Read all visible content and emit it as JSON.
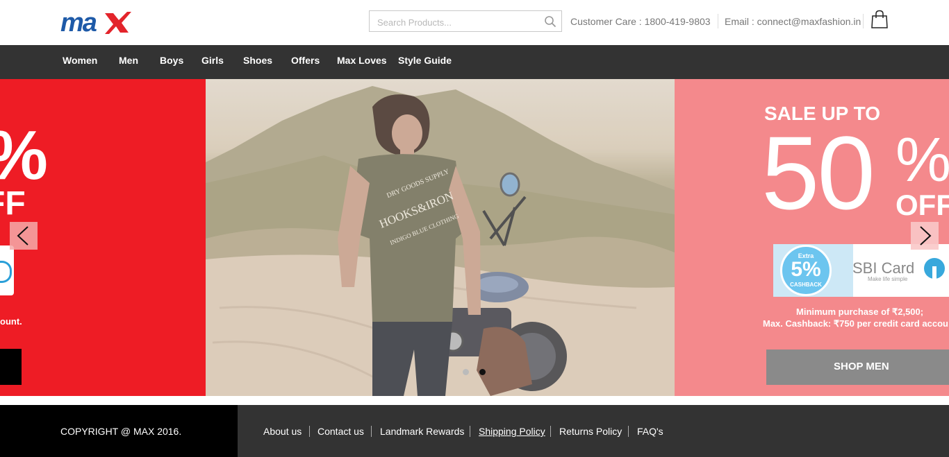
{
  "header": {
    "logo_text": "max",
    "search_placeholder": "Search Products...",
    "customer_care": "Customer Care : 1800-419-9803",
    "email": "Email : connect@maxfashion.in"
  },
  "nav": {
    "items": [
      "Women",
      "Men",
      "Boys",
      "Girls",
      "Shoes",
      "Offers",
      "Max Loves",
      "Style Guide"
    ]
  },
  "banner": {
    "left_slide": {
      "big": "%",
      "off": "FF",
      "note": "ount."
    },
    "center_slide": {
      "shirt_text": [
        "DRY GOODS SUPPLY",
        "HOOKS&IRON",
        "INDIGO BLUE CLOTHING"
      ]
    },
    "right_slide": {
      "sale_label": "SALE UP TO",
      "discount_number": "50",
      "discount_pct": "%",
      "discount_off": "OFF",
      "card_extra": "Extra",
      "card_percent": "5%",
      "card_cashback": "CASHBACK",
      "card_brand": "SBI Card",
      "card_tagline": "Make life simple",
      "min_purchase": "Minimum purchase of ₹2,500;",
      "max_cashback": "Max. Cashback: ₹750 per credit card accou",
      "shop_label": "SHOP MEN"
    },
    "active_dot": 2,
    "dot_count": 2
  },
  "footer": {
    "copyright": "COPYRIGHT @ MAX 2016.",
    "links": [
      "About us",
      "Contact us",
      "Landmark Rewards",
      "Shipping Policy",
      "Returns Policy",
      "FAQ's"
    ]
  },
  "colors": {
    "brand_blue": "#1e5aa8",
    "brand_red": "#e3242b",
    "nav_bg": "#333333",
    "left_slide_bg": "#ee1c25",
    "right_slide_bg": "#f4898c"
  }
}
